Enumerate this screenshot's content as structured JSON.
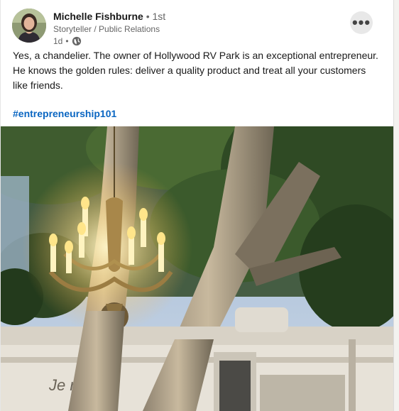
{
  "post": {
    "author_name": "Michelle Fishburne",
    "connection_degree": "1st",
    "headline": "Storyteller / Public Relations",
    "time_ago": "1d",
    "text": "Yes, a chandelier. The owner of Hollywood RV Park is an exceptional entrepreneur. He knows the golden rules: deliver a quality product and treat all your customers like friends.",
    "hashtag": "#entrepreneurship101",
    "more_icon": "ellipsis-icon",
    "visibility_icon": "globe-icon",
    "rv_text": "Je      ree"
  },
  "colors": {
    "link": "#0a66c2",
    "text": "#191919",
    "muted": "#666666"
  }
}
